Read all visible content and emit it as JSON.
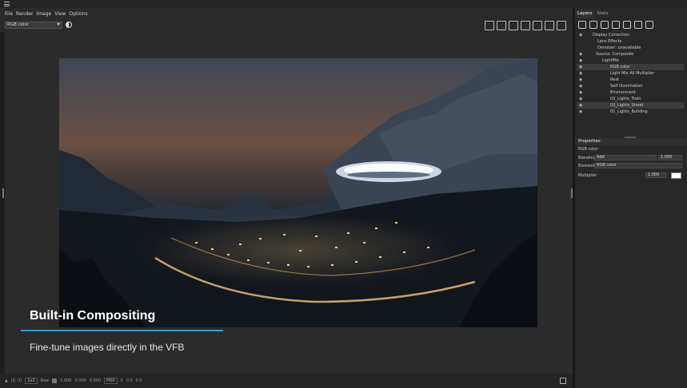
{
  "menubar": {
    "items": [
      "File",
      "Render",
      "Image",
      "View",
      "Options"
    ]
  },
  "vfb_toolbar": {
    "channel": "RGB color"
  },
  "caption": {
    "title": "Built-in Compositing",
    "subtitle": "Fine-tune images directly in the VFB",
    "rule_color": "#2f9fd8"
  },
  "statusbar": {
    "coords": "[0, 0]",
    "zoom": "1x1",
    "raw_label": "Raw",
    "values": [
      "0.000",
      "0.000",
      "0.000"
    ],
    "color_mode": "HSV",
    "hsv_values": [
      "0",
      "0.0",
      "0.0"
    ]
  },
  "panel": {
    "tabs": [
      "Layers",
      "Stats"
    ],
    "layers": [
      {
        "label": "Display Correction"
      },
      {
        "label": "Lens Effects"
      },
      {
        "label": "Denoiser: unavailable"
      },
      {
        "label": "Source: Composite"
      },
      {
        "label": "LightMix"
      },
      {
        "label": "RGB color"
      },
      {
        "label": "Light Mix All Multiplier"
      },
      {
        "label": "Rest"
      },
      {
        "label": "Self Illumination"
      },
      {
        "label": "Environment"
      },
      {
        "label": "03_Lights_Train"
      },
      {
        "label": "02_Lights_Street"
      },
      {
        "label": "01_Lights_Building"
      }
    ],
    "properties": {
      "header": "Properties",
      "layer_name": "RGB color",
      "blending_label": "Blending",
      "blending_value": "Add",
      "blending_amount": "1.000",
      "element_label": "Element",
      "element_value": "RGB color",
      "multiplier_label": "Multiplier",
      "multiplier_value": "1.000"
    }
  }
}
